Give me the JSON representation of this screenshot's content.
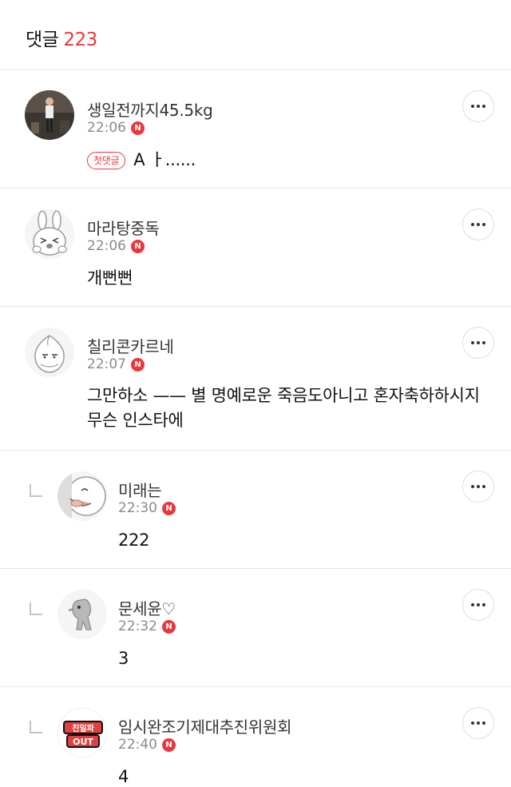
{
  "header": {
    "title": "댓글",
    "count": "223"
  },
  "comments": [
    {
      "author": "생일전까지45.5kg",
      "time": "22:06",
      "badge": "N",
      "tag": "첫댓글",
      "text": "A ㅏ......",
      "avatar": "photo-avatar"
    },
    {
      "author": "마라탕중독",
      "time": "22:06",
      "badge": "N",
      "text": "개뻔뻔",
      "avatar": "rabbit-character-avatar"
    },
    {
      "author": "칠리콘카르네",
      "time": "22:07",
      "badge": "N",
      "text": "그만하소 —— 별 명예로운 죽음도아니고 혼자축하하시지 무슨 인스타에",
      "avatar": "peach-character-avatar"
    },
    {
      "author": "미래는",
      "time": "22:30",
      "badge": "N",
      "text": "222",
      "avatar": "face-character-avatar",
      "reply": true
    },
    {
      "author": "문세윤♡",
      "time": "22:32",
      "badge": "N",
      "text": "3",
      "avatar": "gray-character-avatar",
      "reply": true
    },
    {
      "author": "임시완조기제대추진위원회",
      "time": "22:40",
      "badge": "N",
      "text": "4",
      "avatar": "text-logo-avatar",
      "avatar_text": "친일파 OUT",
      "reply": true
    }
  ],
  "colors": {
    "accent": "#e8383d",
    "divider": "#e6e6e6",
    "meta": "#8a8a8a"
  }
}
